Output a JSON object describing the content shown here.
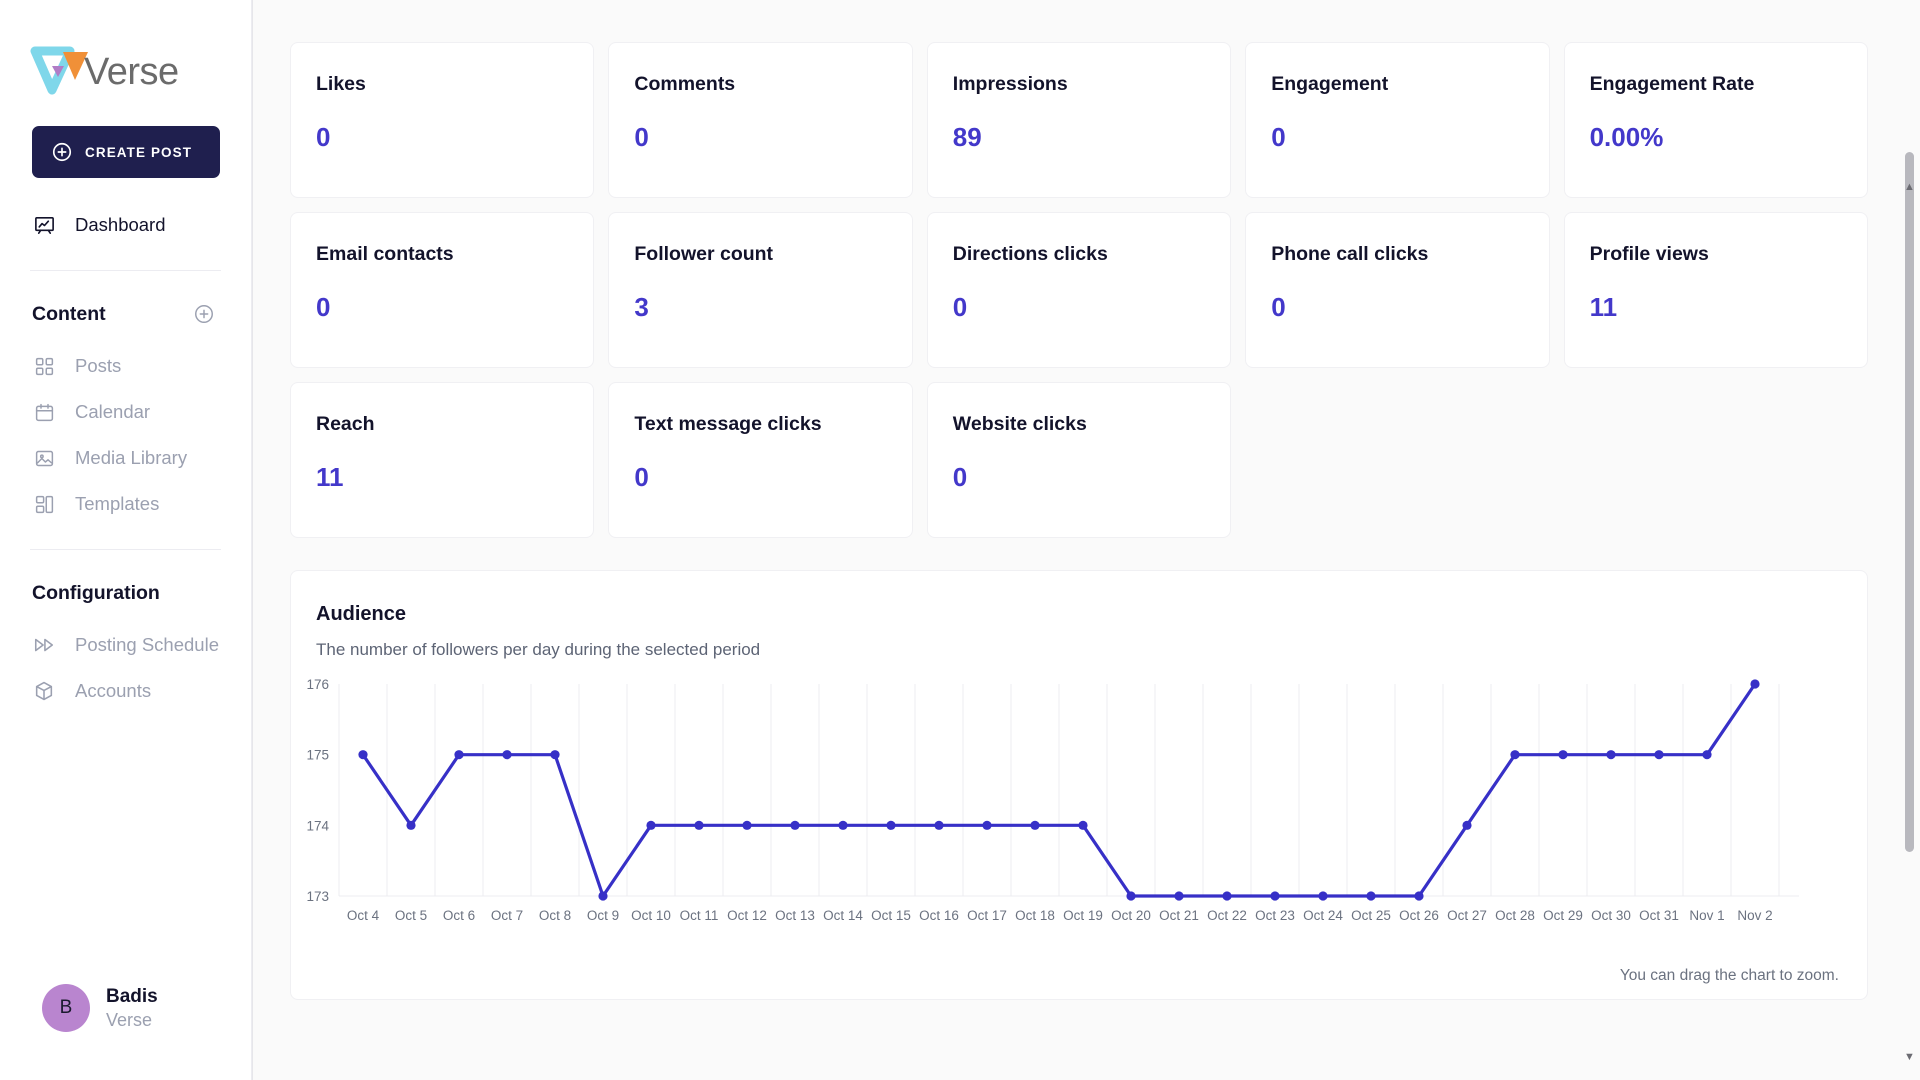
{
  "brand": {
    "logo_text": "Verse",
    "logo_colors": {
      "cyan": "#7fd7ea",
      "orange": "#f09038",
      "purple": "#b07cc6",
      "text": "#6b6b6b"
    }
  },
  "sidebar": {
    "create_post_label": "CREATE POST",
    "primary_items": [
      {
        "label": "Dashboard",
        "icon": "dashboard-chart-icon",
        "active": true
      }
    ],
    "content_section": {
      "title": "Content",
      "add_icon": "plus-circle-icon"
    },
    "content_items": [
      {
        "label": "Posts",
        "icon": "grid-squares-icon"
      },
      {
        "label": "Calendar",
        "icon": "calendar-icon"
      },
      {
        "label": "Media Library",
        "icon": "image-icon"
      },
      {
        "label": "Templates",
        "icon": "templates-icon"
      }
    ],
    "configuration_section": {
      "title": "Configuration"
    },
    "configuration_items": [
      {
        "label": "Posting Schedule",
        "icon": "fast-forward-icon"
      },
      {
        "label": "Accounts",
        "icon": "cube-icon"
      }
    ],
    "user": {
      "initial": "B",
      "name": "Badis",
      "org": "Verse"
    }
  },
  "stats": [
    {
      "label": "Likes",
      "value": "0"
    },
    {
      "label": "Comments",
      "value": "0"
    },
    {
      "label": "Impressions",
      "value": "89"
    },
    {
      "label": "Engagement",
      "value": "0"
    },
    {
      "label": "Engagement Rate",
      "value": "0.00%"
    },
    {
      "label": "Email contacts",
      "value": "0"
    },
    {
      "label": "Follower count",
      "value": "3"
    },
    {
      "label": "Directions clicks",
      "value": "0"
    },
    {
      "label": "Phone call clicks",
      "value": "0"
    },
    {
      "label": "Profile views",
      "value": "11"
    },
    {
      "label": "Reach",
      "value": "11"
    },
    {
      "label": "Text message clicks",
      "value": "0"
    },
    {
      "label": "Website clicks",
      "value": "0"
    }
  ],
  "chart_panel": {
    "title": "Audience",
    "subtitle": "The number of followers per day during the selected period",
    "hint": "You can drag the chart to zoom."
  },
  "colors": {
    "accent": "#4338ca",
    "line": "#3730c7",
    "sidebar_muted": "#9ba0b0",
    "dark": "#13132b",
    "button_bg": "#1f1f4e",
    "page_bg": "#fafafa"
  },
  "chart_data": {
    "type": "line",
    "title": "Audience",
    "subtitle": "The number of followers per day during the selected period",
    "xlabel": "",
    "ylabel": "",
    "ylim": [
      173,
      176
    ],
    "yticks": [
      173,
      174,
      175,
      176
    ],
    "grid": true,
    "legend": "none",
    "x": [
      "Oct 4",
      "Oct 5",
      "Oct 6",
      "Oct 7",
      "Oct 8",
      "Oct 9",
      "Oct 10",
      "Oct 11",
      "Oct 12",
      "Oct 13",
      "Oct 14",
      "Oct 15",
      "Oct 16",
      "Oct 17",
      "Oct 18",
      "Oct 19",
      "Oct 20",
      "Oct 21",
      "Oct 22",
      "Oct 23",
      "Oct 24",
      "Oct 25",
      "Oct 26",
      "Oct 27",
      "Oct 28",
      "Oct 29",
      "Oct 30",
      "Oct 31",
      "Nov 1",
      "Nov 2"
    ],
    "values": [
      175,
      174,
      175,
      175,
      175,
      173,
      174,
      174,
      174,
      174,
      174,
      174,
      174,
      174,
      174,
      174,
      173,
      173,
      173,
      173,
      173,
      173,
      173,
      174,
      175,
      175,
      175,
      175,
      175,
      176
    ],
    "series": [
      {
        "name": "Followers",
        "color": "#3730c7",
        "values": [
          175,
          174,
          175,
          175,
          175,
          173,
          174,
          174,
          174,
          174,
          174,
          174,
          174,
          174,
          174,
          174,
          173,
          173,
          173,
          173,
          173,
          173,
          173,
          174,
          175,
          175,
          175,
          175,
          175,
          176
        ]
      }
    ]
  }
}
